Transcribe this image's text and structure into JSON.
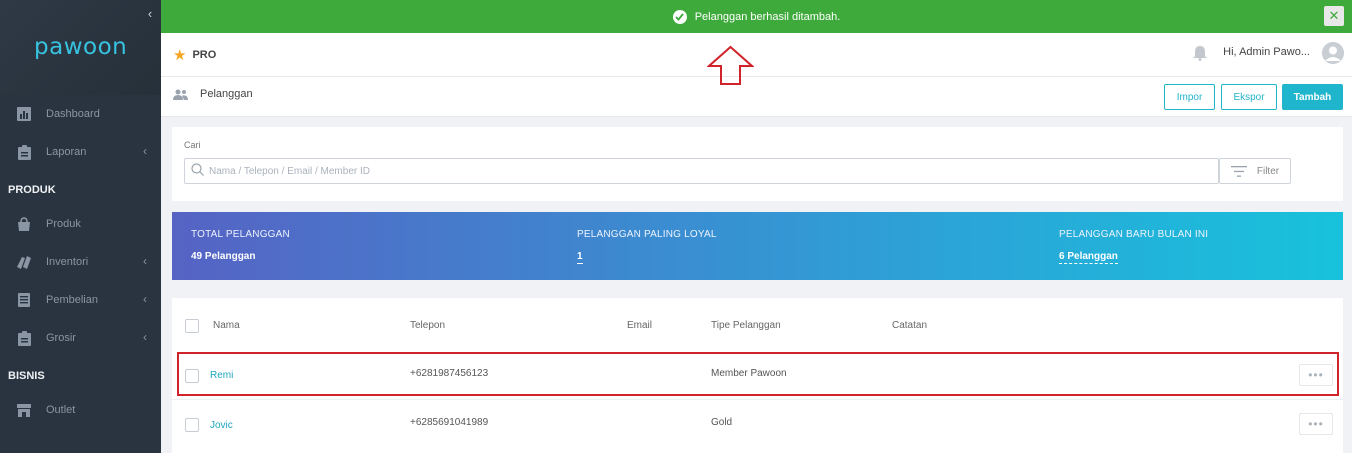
{
  "toast": {
    "message": "Pelanggan berhasil ditambah."
  },
  "sidebar": {
    "logo": "pawoon",
    "items_top": [
      {
        "label": "Dashboard",
        "icon": "bar-chart-icon",
        "has_submenu": false
      },
      {
        "label": "Laporan",
        "icon": "clipboard-icon",
        "has_submenu": true
      }
    ],
    "section_produk": "PRODUK",
    "items_produk": [
      {
        "label": "Produk",
        "icon": "shopping-bag-icon",
        "has_submenu": false
      },
      {
        "label": "Inventori",
        "icon": "inventory-icon",
        "has_submenu": true
      },
      {
        "label": "Pembelian",
        "icon": "document-icon",
        "has_submenu": true
      },
      {
        "label": "Grosir",
        "icon": "clipboard-icon",
        "has_submenu": true
      }
    ],
    "section_bisnis": "BISNIS",
    "items_bisnis": [
      {
        "label": "Outlet",
        "icon": "store-icon",
        "has_submenu": false
      }
    ]
  },
  "topbar": {
    "plan": "PRO",
    "greeting": "Hi, Admin Pawo..."
  },
  "page": {
    "title": "Pelanggan",
    "import_label": "Impor",
    "export_label": "Ekspor",
    "add_label": "Tambah"
  },
  "search": {
    "label": "Cari",
    "placeholder": "Nama / Telepon / Email / Member ID",
    "filter_label": "Filter"
  },
  "stats": {
    "total_label": "TOTAL PELANGGAN",
    "total_value": "49 Pelanggan",
    "loyal_label": "PELANGGAN PALING LOYAL",
    "loyal_value": "1",
    "new_label": "PELANGGAN BARU BULAN INI",
    "new_value": "6 Pelanggan"
  },
  "table": {
    "columns": [
      "Nama",
      "Telepon",
      "Email",
      "Tipe Pelanggan",
      "Catatan"
    ],
    "rows": [
      {
        "name": "Remi",
        "phone": "+6281987456123",
        "email": "",
        "type": "Member Pawoon",
        "note": ""
      },
      {
        "name": "Jovic",
        "phone": "+6285691041989",
        "email": "",
        "type": "Gold",
        "note": ""
      }
    ]
  },
  "colors": {
    "sidebar_bg": "#2a3340",
    "toast_bg": "#3eaa3b",
    "accent": "#1fb5cc",
    "highlight": "#d0232a"
  }
}
